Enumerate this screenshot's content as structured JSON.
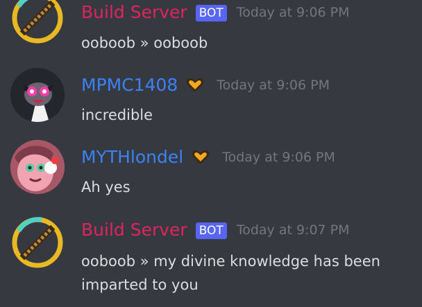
{
  "colors": {
    "background": "#36393f",
    "build_server_name": "#e0245e",
    "member_name": "#3b82f6",
    "bot_badge": "#5865f2",
    "timestamp": "#72767d",
    "message_text": "#dcddde",
    "heart": "#f5a623"
  },
  "messages": [
    {
      "author": "Build Server",
      "badge": "BOT",
      "avatar_icon": "golden-sword-icon",
      "timestamp": "Today at 9:06 PM",
      "lines": [
        "ooboob » ooboob"
      ]
    },
    {
      "author": "MPMC1408",
      "badge_icon": "orange-heart-icon",
      "avatar_icon": "cartoon-character-avatar",
      "timestamp": "Today at 9:06 PM",
      "lines": [
        "incredible"
      ]
    },
    {
      "author": "MYTHlondel",
      "badge_icon": "orange-heart-icon",
      "avatar_icon": "pink-character-avatar",
      "timestamp": "Today at 9:06 PM",
      "lines": [
        "Ah yes"
      ]
    },
    {
      "author": "Build Server",
      "badge": "BOT",
      "avatar_icon": "golden-sword-icon",
      "timestamp": "Today at 9:07 PM",
      "lines": [
        "ooboob » my divine knowledge has been",
        "imparted to you"
      ]
    }
  ]
}
